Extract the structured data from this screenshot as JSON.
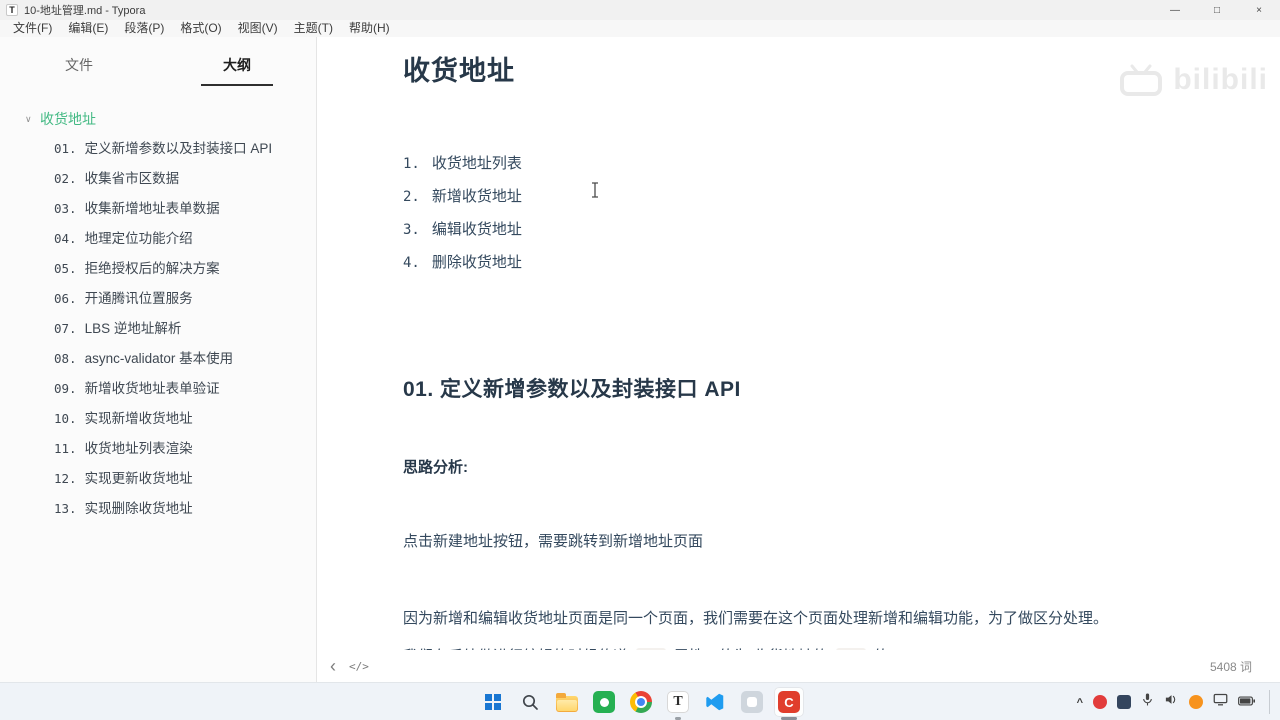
{
  "colors": {
    "accent_green": "#42b983",
    "code_text": "#e96900",
    "code_bg": "#f4f1ee",
    "taskbar_bg": "#eff3f8"
  },
  "icons": {
    "minimize": "—",
    "maximize": "□",
    "close": "×",
    "collapse": "∨",
    "nav_back": "‹",
    "source_mode": "</>",
    "tray_chevron": "^"
  },
  "window": {
    "title": "10-地址管理.md - Typora",
    "app_icon_letter": "T",
    "menu": [
      "文件(F)",
      "编辑(E)",
      "段落(P)",
      "格式(O)",
      "视图(V)",
      "主题(T)",
      "帮助(H)"
    ]
  },
  "sidebar": {
    "tabs": {
      "files": "文件",
      "outline": "大纲"
    },
    "outline_root": "收货地址",
    "outline_items": [
      {
        "num": "01.",
        "label": "定义新增参数以及封装接口 API"
      },
      {
        "num": "02.",
        "label": "收集省市区数据"
      },
      {
        "num": "03.",
        "label": "收集新增地址表单数据"
      },
      {
        "num": "04.",
        "label": "地理定位功能介绍"
      },
      {
        "num": "05.",
        "label": "拒绝授权后的解决方案"
      },
      {
        "num": "06.",
        "label": "开通腾讯位置服务"
      },
      {
        "num": "07.",
        "label": "LBS 逆地址解析"
      },
      {
        "num": "08.",
        "label": "async-validator 基本使用"
      },
      {
        "num": "09.",
        "label": "新增收货地址表单验证"
      },
      {
        "num": "10.",
        "label": "实现新增收货地址"
      },
      {
        "num": "11.",
        "label": "收货地址列表渲染"
      },
      {
        "num": "12.",
        "label": "实现更新收货地址"
      },
      {
        "num": "13.",
        "label": "实现删除收货地址"
      }
    ]
  },
  "content": {
    "h1": "收货地址",
    "toc": [
      {
        "num": "1.",
        "label": "收货地址列表"
      },
      {
        "num": "2.",
        "label": "新增收货地址"
      },
      {
        "num": "3.",
        "label": "编辑收货地址"
      },
      {
        "num": "4.",
        "label": "删除收货地址"
      }
    ],
    "h2": "01. 定义新增参数以及封装接口 API",
    "analysis_label": "思路分析:",
    "p1": "点击新建地址按钮，需要跳转到新增地址页面",
    "p2": "因为新增和编辑收货地址页面是同一个页面，我们需要在这个页面处理新增和编辑功能，为了做区分处理。",
    "p3": {
      "part1": "我们在后续做进行编辑的时候传递",
      "code1": "id",
      "part2": "属性，值为 收货地址的",
      "code2": "id",
      "part3": "值。"
    }
  },
  "watermark": {
    "text": "bilibili"
  },
  "statusbar": {
    "word_count": "5408 词"
  },
  "taskbar": {
    "typora_letter": "T",
    "red_app_letter": "C"
  }
}
